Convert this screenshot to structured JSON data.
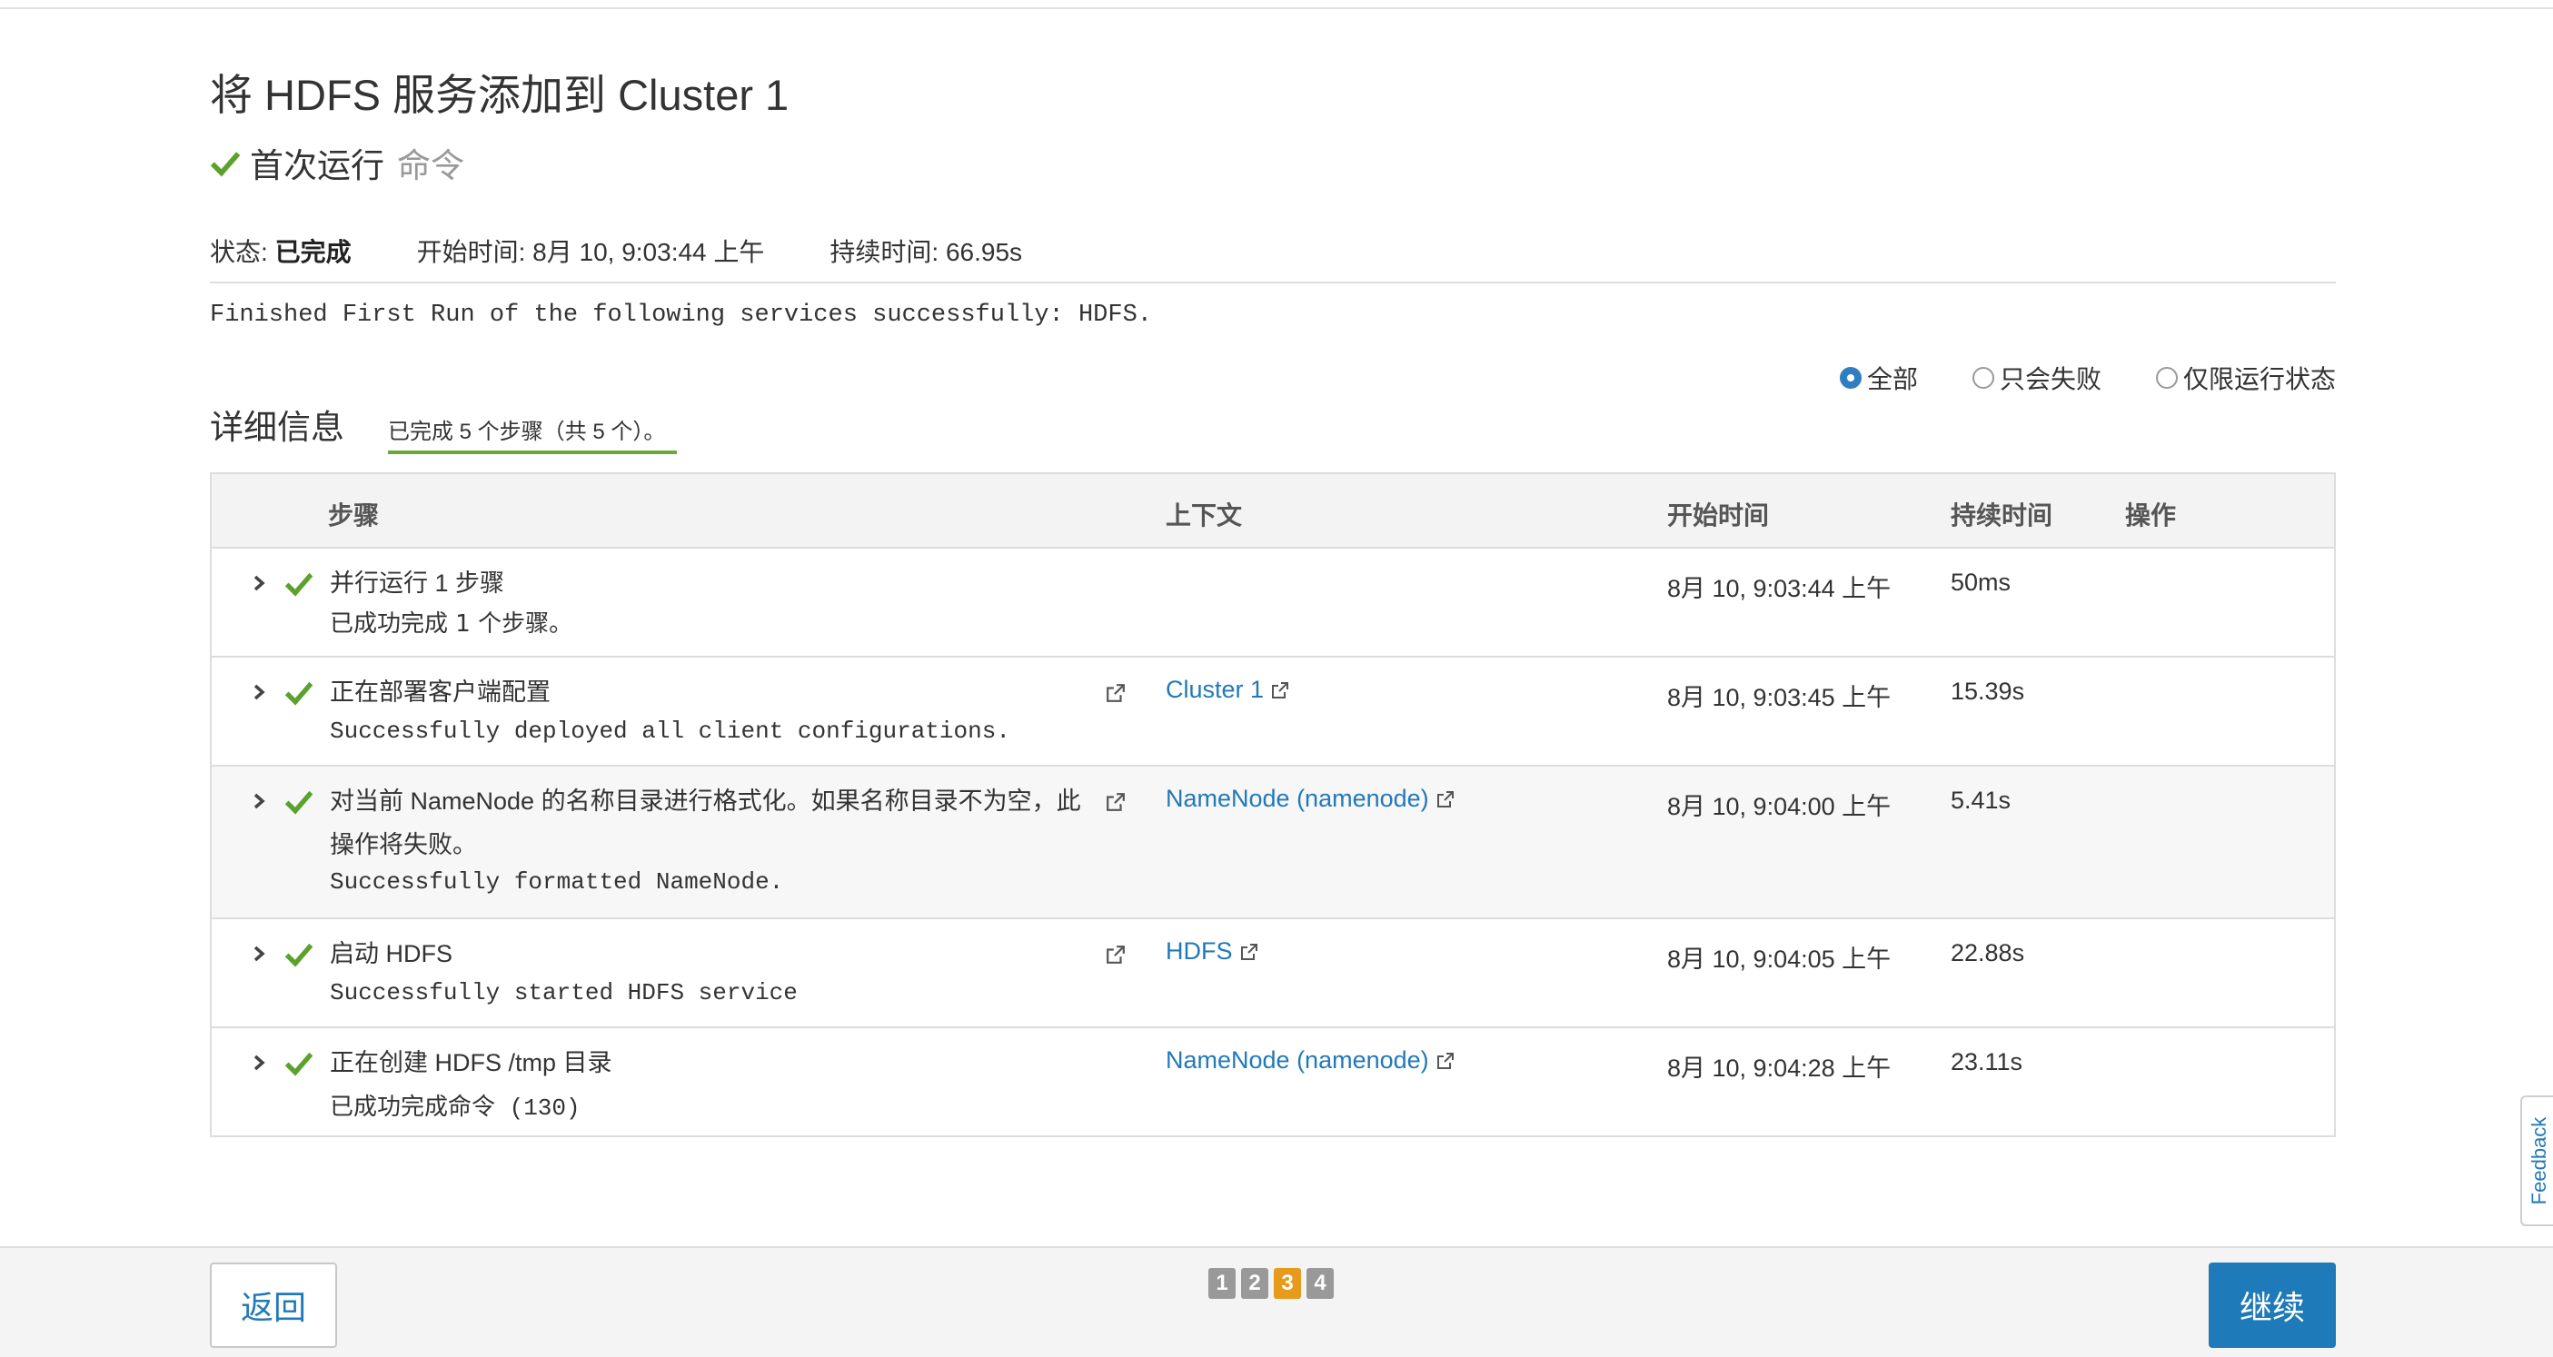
{
  "header": {
    "title": "将 HDFS 服务添加到 Cluster 1",
    "command_name": "首次运行",
    "command_suffix": "命令"
  },
  "status": {
    "state_label": "状态:",
    "state_value": "已完成",
    "start_label": "开始时间:",
    "start_value": "8月 10, 9:03:44 上午",
    "duration_label": "持续时间:",
    "duration_value": "66.95s"
  },
  "message": "Finished First Run of the following services successfully: HDFS.",
  "filters": {
    "all": "全部",
    "failed_only": "只会失败",
    "running_only": "仅限运行状态",
    "selected": "all"
  },
  "details": {
    "label": "详细信息",
    "progress_text": "已完成 5 个步骤（共 5 个）。",
    "progress_fraction": 1.0
  },
  "table": {
    "headers": {
      "step": "步骤",
      "context": "上下文",
      "start_time": "开始时间",
      "duration": "持续时间",
      "actions": "操作"
    },
    "rows": [
      {
        "title": "并行运行 1 步骤",
        "subtitle": "已成功完成  1  个步骤。",
        "context": "",
        "start": "8月 10, 9:03:44 上午",
        "duration": "50ms"
      },
      {
        "title": "正在部署客户端配置",
        "subtitle": "Successfully deployed all client configurations.",
        "context": "Cluster 1",
        "start": "8月 10, 9:03:45 上午",
        "duration": "15.39s"
      },
      {
        "title": "对当前 NameNode 的名称目录进行格式化。如果名称目录不为空，此操作将失败。",
        "subtitle": "Successfully formatted NameNode.",
        "context": "NameNode (namenode)",
        "start": "8月 10, 9:04:00 上午",
        "duration": "5.41s"
      },
      {
        "title": "启动 HDFS",
        "subtitle": "Successfully started HDFS service",
        "context": "HDFS",
        "start": "8月 10, 9:04:05 上午",
        "duration": "22.88s"
      },
      {
        "title": "正在创建 HDFS /tmp 目录",
        "subtitle": "已成功完成命令 (130)",
        "context": "NameNode (namenode)",
        "start": "8月 10, 9:04:28 上午",
        "duration": "23.11s"
      }
    ]
  },
  "footer": {
    "back_label": "返回",
    "continue_label": "继续",
    "pages": [
      "1",
      "2",
      "3",
      "4"
    ],
    "current_page": "3"
  },
  "feedback_label": "Feedback",
  "colors": {
    "success_green": "#5ba22c",
    "link_blue": "#2279b8",
    "primary_button": "#1e7ab8",
    "active_page": "#e79b1d"
  }
}
